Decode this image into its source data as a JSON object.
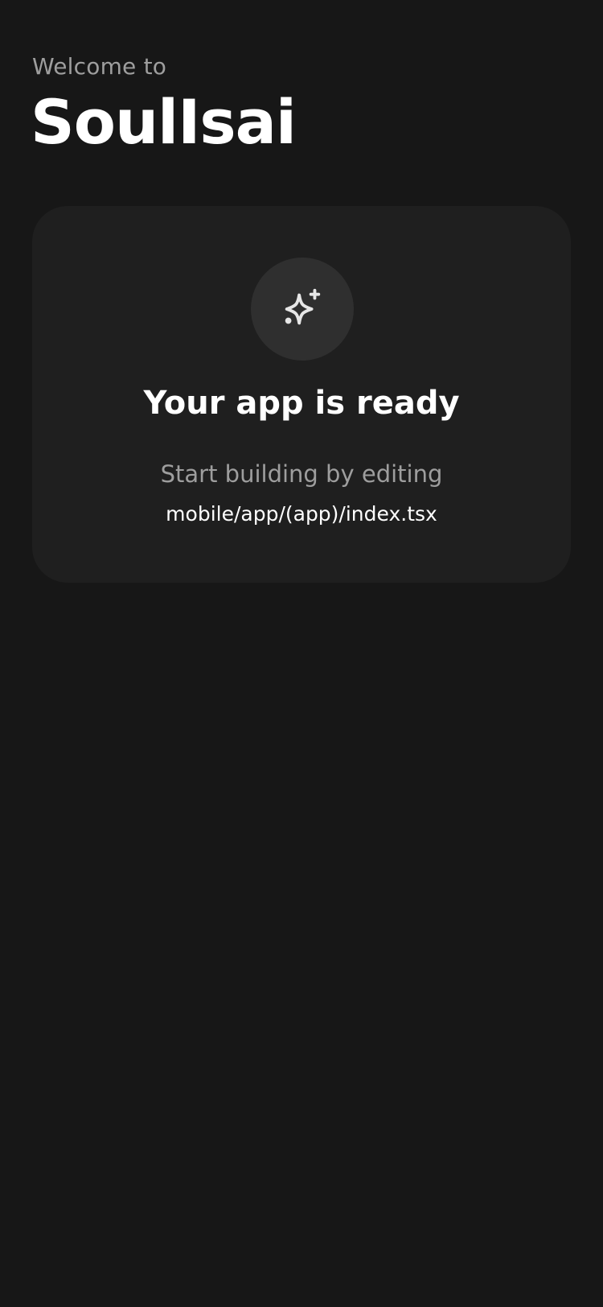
{
  "header": {
    "welcome": "Welcome to",
    "title": "SoulIsai"
  },
  "card": {
    "icon": "sparkles-icon",
    "heading": "Your app is ready",
    "subtitle": "Start building by editing",
    "file_path": "mobile/app/(app)/index.tsx"
  },
  "colors": {
    "background": "#171717",
    "card": "#1f1f1f",
    "icon_circle": "#2f2f2f",
    "muted_text": "#9e9e9e",
    "text": "#ffffff"
  }
}
